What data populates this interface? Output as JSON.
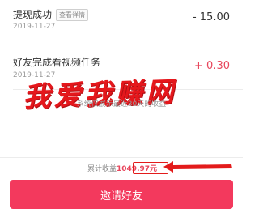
{
  "records": [
    {
      "title": "提现成功",
      "tag": "查看详情",
      "date": "2019-11-27",
      "amount": "- 15.00"
    },
    {
      "title": "好友完成看视频任务",
      "date": "2019-11-27",
      "amount": "+ 0.30"
    }
  ],
  "watermark": "我爱我赚网",
  "footnote": "系统仅展示最近30天的收益",
  "summary": {
    "label": "累计收益",
    "value": "1049.97元"
  },
  "button": {
    "label": "邀请好友"
  },
  "colors": {
    "income": "#e8465c",
    "expense": "#333333",
    "button": "#f3395d",
    "annotation": "#e31b1b"
  }
}
